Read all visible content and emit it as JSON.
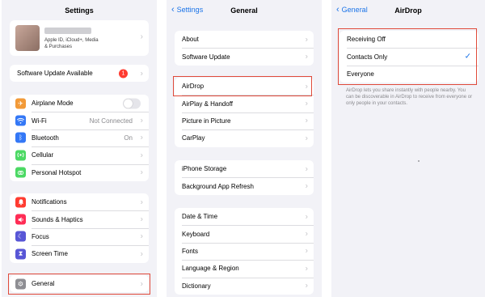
{
  "settings": {
    "title": "Settings",
    "profile_sub_line1": "Apple ID, iCloud+, Media",
    "profile_sub_line2": "& Purchases",
    "software_update": {
      "label": "Software Update Available",
      "badge": "1"
    },
    "group1": [
      {
        "label": "Airplane Mode",
        "icon": "airplane-icon",
        "color": "#f29a38"
      },
      {
        "label": "Wi-Fi",
        "value": "Not Connected",
        "icon": "wifi-icon",
        "color": "#3478f6"
      },
      {
        "label": "Bluetooth",
        "value": "On",
        "icon": "bluetooth-icon",
        "color": "#3478f6"
      },
      {
        "label": "Cellular",
        "icon": "cellular-icon",
        "color": "#4cd964"
      },
      {
        "label": "Personal Hotspot",
        "icon": "hotspot-icon",
        "color": "#4cd964"
      }
    ],
    "group2": [
      {
        "label": "Notifications",
        "icon": "bell-icon",
        "color": "#ff3b30"
      },
      {
        "label": "Sounds & Haptics",
        "icon": "speaker-icon",
        "color": "#ff2d55"
      },
      {
        "label": "Focus",
        "icon": "moon-icon",
        "color": "#5856d6"
      },
      {
        "label": "Screen Time",
        "icon": "hourglass-icon",
        "color": "#5856d6"
      }
    ],
    "general": {
      "label": "General",
      "icon": "gear-icon",
      "color": "#8e8e93"
    }
  },
  "general": {
    "back_label": "Settings",
    "title": "General",
    "group1": [
      "About",
      "Software Update"
    ],
    "group2": [
      "AirDrop",
      "AirPlay & Handoff",
      "Picture in Picture",
      "CarPlay"
    ],
    "group3": [
      "iPhone Storage",
      "Background App Refresh"
    ],
    "group4": [
      "Date & Time",
      "Keyboard",
      "Fonts",
      "Language & Region",
      "Dictionary"
    ]
  },
  "airdrop": {
    "back_label": "General",
    "title": "AirDrop",
    "options": [
      "Receiving Off",
      "Contacts Only",
      "Everyone"
    ],
    "selected": "Contacts Only",
    "footer": "AirDrop lets you share instantly with people nearby. You can be discoverable in AirDrop to receive from everyone or only people in your contacts."
  }
}
